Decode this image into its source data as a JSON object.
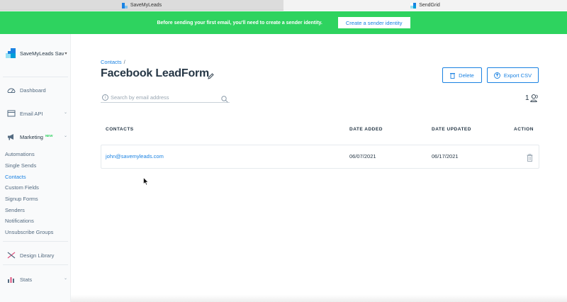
{
  "browser": {
    "tabs": [
      {
        "label": "SaveMyLeads",
        "active": false
      },
      {
        "label": "SendGrid",
        "active": true
      }
    ]
  },
  "banner": {
    "text": "Before sending your first email, you'll need to create a sender identity.",
    "button_label": "Create a sender identity",
    "color": "#2ed35f"
  },
  "sidebar": {
    "account_name": "SaveMyLeads Sav",
    "nav": {
      "dashboard": "Dashboard",
      "email_api": "Email API",
      "marketing": "Marketing",
      "marketing_badge": "NEW",
      "design_library": "Design Library",
      "stats": "Stats"
    },
    "marketing_items": [
      {
        "label": "Automations",
        "active": false
      },
      {
        "label": "Single Sends",
        "active": false
      },
      {
        "label": "Contacts",
        "active": true
      },
      {
        "label": "Custom Fields",
        "active": false
      },
      {
        "label": "Signup Forms",
        "active": false
      },
      {
        "label": "Senders",
        "active": false
      },
      {
        "label": "Notifications",
        "active": false
      },
      {
        "label": "Unsubscribe Groups",
        "active": false
      }
    ]
  },
  "main": {
    "breadcrumb": "Contacts",
    "breadcrumb_sep": "/",
    "title": "Facebook LeadForm",
    "delete_label": "Delete",
    "export_label": "Export CSV",
    "search_placeholder": "Search by email address",
    "contact_count": "1",
    "table": {
      "headers": {
        "contacts": "CONTACTS",
        "date_added": "DATE ADDED",
        "date_updated": "DATE UPDATED",
        "action": "ACTION"
      },
      "rows": [
        {
          "email": "john@savemyleads.com",
          "date_added": "06/07/2021",
          "date_updated": "06/17/2021"
        }
      ]
    }
  },
  "colors": {
    "accent": "#1a82e2",
    "text": "#263746",
    "brand_green": "#2ed35f"
  }
}
